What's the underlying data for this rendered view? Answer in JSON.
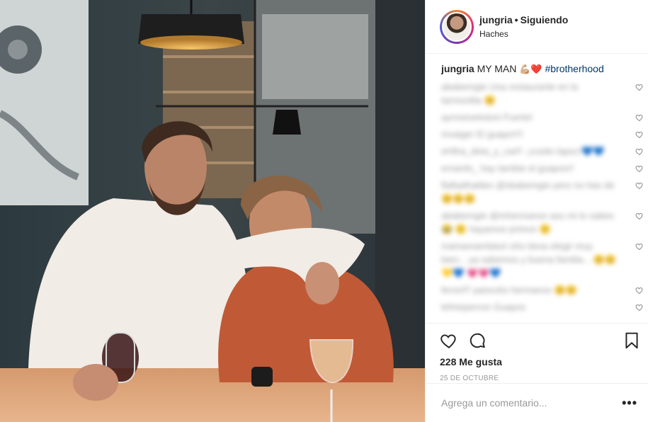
{
  "post": {
    "username": "jungria",
    "follow_state": "Siguiendo",
    "location": "Haches",
    "caption_user": "jungria",
    "caption_text": "MY MAN",
    "caption_emoji": "💪🏼❤️",
    "caption_hashtag": "#brotherhood",
    "likes": "228 Me gusta",
    "date": "25 DE OCTUBRE",
    "comment_placeholder": "Agrega un comentario...",
    "more_icon": "•••"
  },
  "comments": [
    {
      "text": "ababemgie Una restaurante en la tarresolita 😊"
    },
    {
      "text": "ayrosesetotoni Fuerte!"
    },
    {
      "text": "mvaiger El guapo!!!!"
    },
    {
      "text": "eHtha_deta_y_carF: ¡cosito lapoc!💙💙"
    },
    {
      "text": "ernardo_ hay tambie el guapoo!!"
    },
    {
      "text": "flaftadhaldes @sbabemgie pero no has de 😊😊😊"
    },
    {
      "text": "ababemgie @mhermanos asu mi lo sabes 😂 🙂 hayamos primos 🙂"
    },
    {
      "text": "mamamamlatori oho tiena elegir muy bien... ya sabemos y buena familia... 😊😊 💛💙 💗💗💙"
    },
    {
      "text": "ferrerf7 parecéis hermanos 😊😊"
    },
    {
      "text": "lefreeperron Guapos"
    }
  ],
  "icons": {
    "like": "heart-outline",
    "comment": "speech-bubble",
    "save": "bookmark",
    "comment_like": "small-heart"
  },
  "colors": {
    "text": "#262626",
    "muted": "#999999",
    "hashtag": "#00376b",
    "border": "#efefef"
  }
}
